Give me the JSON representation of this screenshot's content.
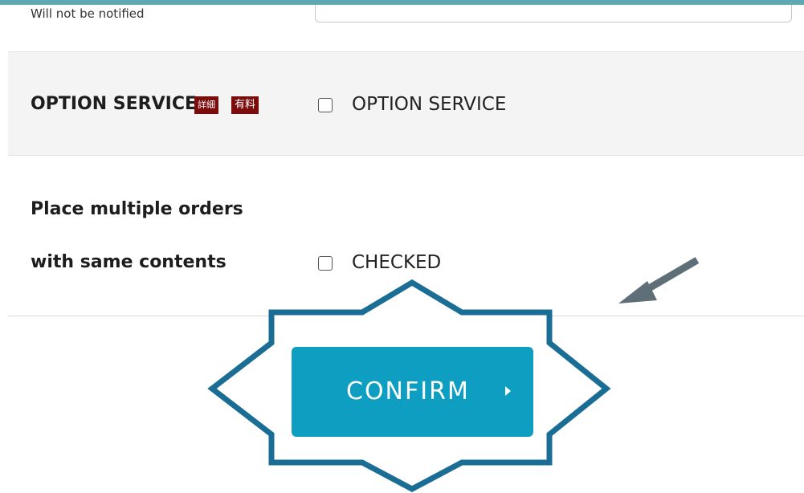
{
  "notification": {
    "note": "Will not be notified"
  },
  "option_service": {
    "label": "OPTION SERVICE",
    "badge_detail": "詳細",
    "badge_paid": "有料",
    "checkbox_label": "OPTION SERVICE"
  },
  "multiple_orders": {
    "label_line1": "Place multiple orders",
    "label_line2": "with same contents",
    "checkbox_label": "CHECKED"
  },
  "confirm": {
    "label": "CONFIRM"
  },
  "icons": {
    "confirm_caret": "caret-right-icon",
    "annotation": "arrow-icon"
  },
  "colors": {
    "accent_teal": "#0e9ec2",
    "badge_red": "#7a0c0c",
    "starburst_outline": "#1a6e95",
    "arrow_gray": "#5f6f78"
  }
}
